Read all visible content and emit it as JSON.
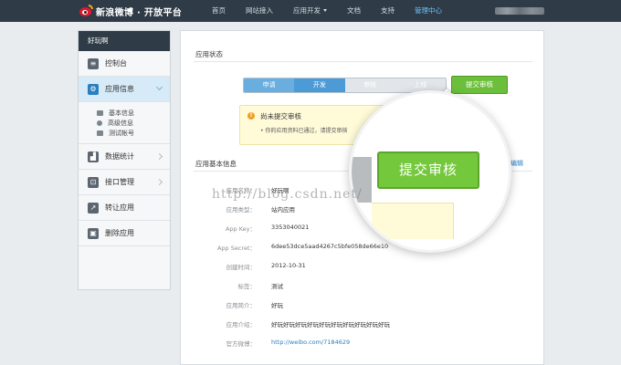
{
  "brand": {
    "logo_text": "新浪微博 · 开放平台"
  },
  "nav": [
    {
      "label": "首页",
      "active": false,
      "dropdown": false
    },
    {
      "label": "网站接入",
      "active": false,
      "dropdown": false
    },
    {
      "label": "应用开发",
      "active": false,
      "dropdown": true
    },
    {
      "label": "文档",
      "active": false,
      "dropdown": false
    },
    {
      "label": "支持",
      "active": false,
      "dropdown": false
    },
    {
      "label": "管理中心",
      "active": true,
      "dropdown": false
    }
  ],
  "sidebar": {
    "app_name": "好玩啊",
    "items": [
      {
        "label": "控制台",
        "icon": "sliders-icon"
      },
      {
        "label": "应用信息",
        "icon": "gear-icon",
        "active": true
      },
      {
        "label": "数据统计",
        "icon": "chart-icon"
      },
      {
        "label": "接口管理",
        "icon": "plug-icon"
      },
      {
        "label": "转让应用",
        "icon": "transfer-icon"
      },
      {
        "label": "删除应用",
        "icon": "trash-icon"
      }
    ],
    "sub_items": [
      "基本信息",
      "高级信息",
      "测试帐号"
    ]
  },
  "status": {
    "section_title": "应用状态",
    "steps": [
      "申请",
      "开发",
      "审核",
      "上线"
    ],
    "current_step_index": 1,
    "submit_label": "提交审核",
    "notice_title": "尚未提交审核",
    "notice_body": "• 你的应用资料已通过，请提交审核"
  },
  "basic_info": {
    "section_title": "应用基本信息",
    "edit_label": "编辑",
    "rows": [
      {
        "key": "应用名称：",
        "value": "好玩啊"
      },
      {
        "key": "应用类型：",
        "value": "站内应用"
      },
      {
        "key": "App Key：",
        "value": "3353040021"
      },
      {
        "key": "App Secret：",
        "value": "6dee53dce5aad4267c5bfe058de66e10"
      },
      {
        "key": "创建时间：",
        "value": "2012-10-31"
      },
      {
        "key": "标签：",
        "value": "测试"
      },
      {
        "key": "应用简介：",
        "value": "好玩"
      },
      {
        "key": "应用介绍：",
        "value": "好玩好玩好玩好玩好玩好玩好玩好玩好玩好玩"
      },
      {
        "key": "官方微博：",
        "value": "http://weibo.com/7184629",
        "link": true
      }
    ]
  },
  "magnifier": {
    "submit_label": "提交审核"
  },
  "watermark": "http://blog.csdn.net/",
  "colors": {
    "topbar": "#2f3b46",
    "accent_blue": "#2a7fc0",
    "submit_green": "#6cbf3a",
    "notice_bg": "#fffbd9"
  }
}
